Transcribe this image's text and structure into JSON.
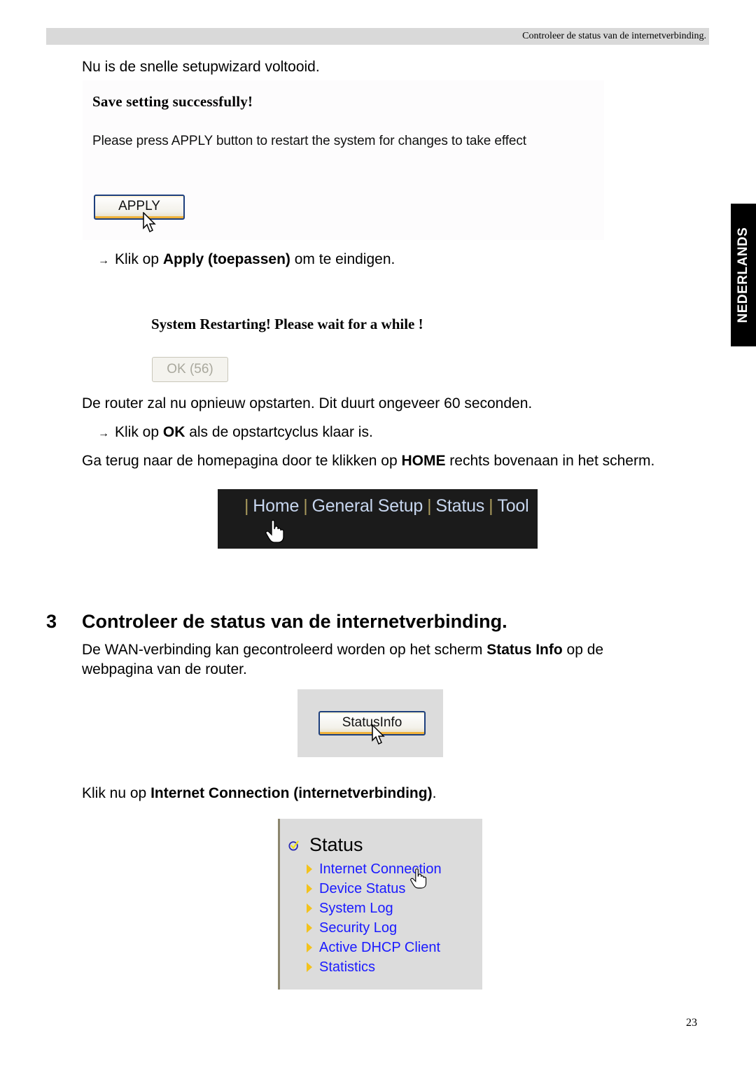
{
  "header": {
    "running_title": "Controleer de status van de internetverbinding."
  },
  "side_tab": {
    "label": "NEDERLANDS"
  },
  "intro": {
    "text": "Nu is de snelle setupwizard voltooid."
  },
  "save_dialog": {
    "title": "Save setting successfully!",
    "message": "Please press APPLY button to restart the system for changes to take effect",
    "apply_button": "APPLY"
  },
  "step_apply": {
    "arrow": "→",
    "pre": "Klik op ",
    "bold": "Apply (toepassen)",
    "post": " om te eindigen."
  },
  "restart_dialog": {
    "title": "System Restarting! Please wait for a while !",
    "ok_button": "OK (56)"
  },
  "restart_info": {
    "text": "De router zal nu opnieuw opstarten. Dit duurt ongeveer 60 seconden."
  },
  "step_ok": {
    "arrow": "→",
    "pre": "Klik op ",
    "bold": "OK",
    "post": " als de opstartcyclus klaar is."
  },
  "home_instruction": {
    "pre": "Ga terug naar de homepagina door te klikken op ",
    "bold": "HOME",
    "post": " rechts bovenaan in het scherm."
  },
  "navbar": {
    "separator": "|",
    "items": [
      "Home",
      "General Setup",
      "Status",
      "Tool"
    ]
  },
  "section": {
    "number": "3",
    "title": "Controleer de status van de internetverbinding."
  },
  "wan_text": {
    "pre": "De WAN-verbinding kan gecontroleerd worden op het scherm ",
    "bold": "Status Info",
    "post": " op de",
    "line2": "webpagina van de router."
  },
  "statusinfo_button": {
    "label": "StatusInfo"
  },
  "internet_instruction": {
    "pre": "Klik nu op ",
    "bold": "Internet Connection (internetverbinding)",
    "post": "."
  },
  "status_menu": {
    "title": "Status",
    "items": [
      "Internet Connection",
      "Device Status",
      "System Log",
      "Security Log",
      "Active DHCP Client",
      "Statistics"
    ]
  },
  "footer": {
    "page_number": "23"
  },
  "colors": {
    "link_blue": "#1a1aff",
    "bullet_yellow": "#f3c21b",
    "navbar_bg": "#1b1b1b",
    "tab_bg": "#000000"
  }
}
